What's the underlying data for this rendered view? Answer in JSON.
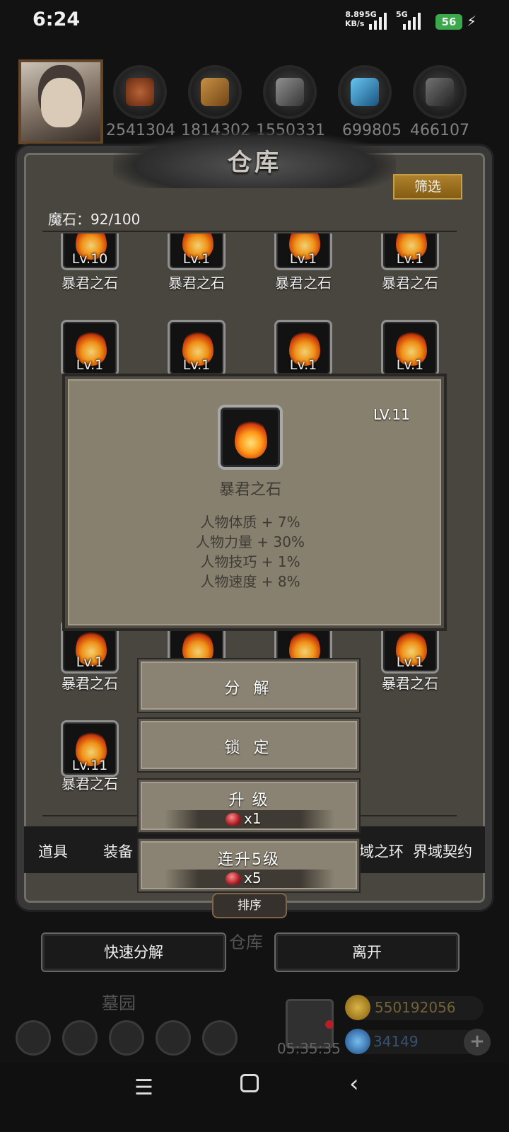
{
  "status": {
    "time": "6:24",
    "speed_value": "8.89",
    "speed_unit": "KB/s",
    "network1": "5G",
    "network2": "5G",
    "battery": "56"
  },
  "resources": [
    "2541304",
    "1814302",
    "1550331",
    "699805",
    "466107"
  ],
  "warehouse": {
    "title": "仓库",
    "filter_label": "筛选",
    "magic_stone_label": "魔石：92/100",
    "sort_label": "排序"
  },
  "items": [
    {
      "lv": "Lv.10",
      "name": "暴君之石"
    },
    {
      "lv": "Lv.1",
      "name": "暴君之石"
    },
    {
      "lv": "Lv.1",
      "name": "暴君之石"
    },
    {
      "lv": "Lv.1",
      "name": "暴君之石"
    },
    {
      "lv": "Lv.1",
      "name": ""
    },
    {
      "lv": "Lv.1",
      "name": ""
    },
    {
      "lv": "Lv.1",
      "name": ""
    },
    {
      "lv": "Lv.1",
      "name": ""
    },
    {
      "lv": "Lv.1",
      "name": "暴君之石"
    },
    {
      "lv": "",
      "name": ""
    },
    {
      "lv": "",
      "name": ""
    },
    {
      "lv": "Lv.1",
      "name": "暴君之石"
    },
    {
      "lv": "Lv.11",
      "name": "暴君之石"
    }
  ],
  "tabs": [
    "道具",
    "装备",
    "域之环",
    "界域契约"
  ],
  "popup": {
    "level": "LV.11",
    "name": "暴君之石",
    "stats": [
      "人物体质 + 7%",
      "人物力量 + 30%",
      "人物技巧 + 1%",
      "人物速度 + 8%"
    ]
  },
  "actions": {
    "decompose": "分 解",
    "lock": "锁 定",
    "upgrade": "升 级",
    "upgrade_cost": "x1",
    "upgrade5": "连升5级",
    "upgrade5_cost": "x5"
  },
  "bottom": {
    "quick_decompose": "快速分解",
    "leave": "离开",
    "ghost_warehouse": "仓库",
    "graveyard": "墓园",
    "timer": "05:35:35",
    "gold": "550192056",
    "diamond": "34149"
  },
  "colors": {
    "panel": "#4e4a43",
    "popup": "#87806f",
    "filter_gold": "#b9892f",
    "battery_green": "#3fb350"
  }
}
